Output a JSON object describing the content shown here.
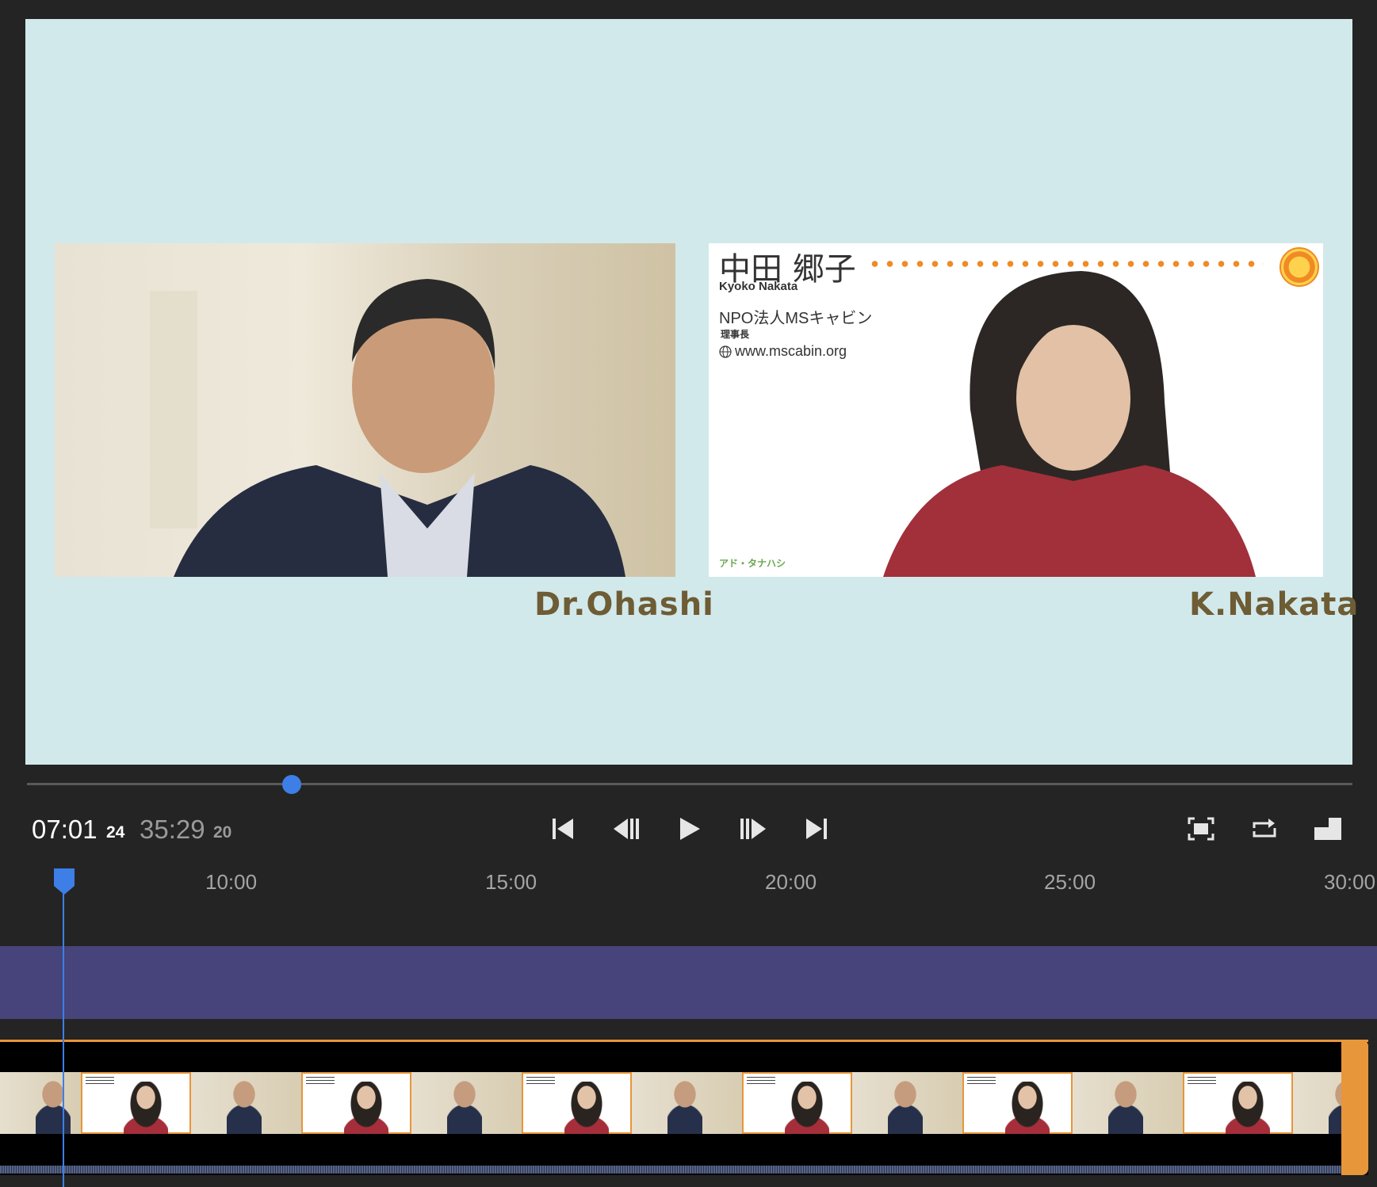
{
  "preview": {
    "left_speaker_name": "Dr.Ohashi",
    "right_speaker_name": "K.Nakata",
    "card": {
      "name_jp": "中田 郷子",
      "name_romaji": "Kyoko Nakata",
      "org": "NPO法人MSキャビン",
      "role": "理事長",
      "url": "www.mscabin.org",
      "footer": "アド・タナハシ"
    }
  },
  "scrubber": {
    "progress": 0.2
  },
  "transport": {
    "current_time": "07:01",
    "current_frames": "24",
    "total_time": "35:29",
    "total_frames": "20",
    "buttons": [
      "skip-to-start",
      "step-back",
      "play",
      "step-forward",
      "skip-to-end",
      "fit-to-screen",
      "loop",
      "picture-in-picture"
    ]
  },
  "timeline": {
    "ruler_ticks": [
      "10:00",
      "15:00",
      "20:00",
      "25:00",
      "30:00"
    ]
  }
}
